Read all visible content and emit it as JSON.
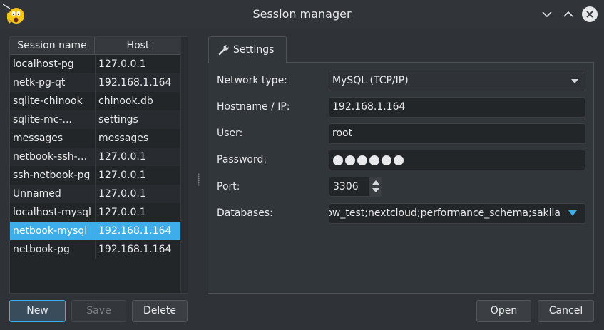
{
  "window": {
    "title": "Session manager",
    "icons": {
      "app": "app-icon",
      "minimize": "chevron-down-icon",
      "maximize": "chevron-up-icon",
      "close": "close-icon"
    }
  },
  "sessions": {
    "columns": [
      "Session name",
      "Host"
    ],
    "rows": [
      {
        "name": "localhost-pg",
        "host": "127.0.0.1"
      },
      {
        "name": "netk-pg-qt",
        "host": "192.168.1.164"
      },
      {
        "name": "sqlite-chinook",
        "host": "chinook.db"
      },
      {
        "name": "sqlite-mc-...",
        "host": "settings"
      },
      {
        "name": "messages",
        "host": "messages"
      },
      {
        "name": "netbook-ssh-...",
        "host": "127.0.0.1"
      },
      {
        "name": "ssh-netbook-pg",
        "host": "127.0.0.1"
      },
      {
        "name": "Unnamed",
        "host": "127.0.0.1"
      },
      {
        "name": "localhost-mysql",
        "host": "127.0.0.1"
      },
      {
        "name": "netbook-mysql",
        "host": "192.168.1.164"
      },
      {
        "name": "netbook-pg",
        "host": "192.168.1.164"
      }
    ],
    "selected_row": "netbook-mysql"
  },
  "settings_tab": {
    "label": "Settings",
    "icon": "wrench-icon"
  },
  "form": {
    "network_type": {
      "label": "Network type:",
      "value": "MySQL (TCP/IP)"
    },
    "hostname": {
      "label": "Hostname / IP:",
      "value": "192.168.1.164"
    },
    "user": {
      "label": "User:",
      "value": "root"
    },
    "password": {
      "label": "Password:",
      "masked_length": 6
    },
    "port": {
      "label": "Port:",
      "value": "3306"
    },
    "databases": {
      "label": "Databases:",
      "value": "ow_test;nextcloud;performance_schema;sakila"
    }
  },
  "buttons": {
    "new": "New",
    "save": "Save",
    "delete": "Delete",
    "open": "Open",
    "cancel": "Cancel"
  },
  "colors": {
    "accent": "#3daee9",
    "background": "#2f3236"
  }
}
